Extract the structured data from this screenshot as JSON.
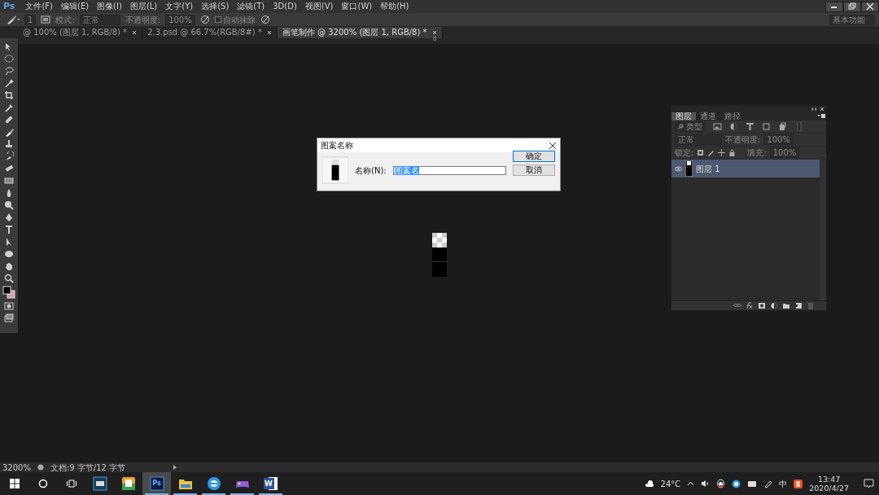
{
  "app": {
    "logo": "Ps",
    "menu": [
      "文件(F)",
      "编辑(E)",
      "图像(I)",
      "图层(L)",
      "文字(Y)",
      "选择(S)",
      "滤镜(T)",
      "3D(D)",
      "视图(V)",
      "窗口(W)",
      "帮助(H)"
    ]
  },
  "options": {
    "brush_size": "1",
    "mode_label": "模式:",
    "mode": "正常",
    "opacity_label": "不透明度:",
    "opacity": "100%",
    "auto_erase": {
      "label": "自动抹除",
      "checked": false
    },
    "workspace": "基本功能"
  },
  "doc_tabs": [
    {
      "label": "@ 100% (图层 1, RGB/8) *",
      "selected": false
    },
    {
      "label": "2.3.psd @ 66.7%(RGB/8#) *",
      "selected": false
    },
    {
      "label": "画笔制作 @ 3200% (图层 1, RGB/8) *",
      "selected": true
    }
  ],
  "ruler": {
    "zero": "0"
  },
  "dialog": {
    "title": "图案名称",
    "name_label": "名称(N):",
    "name_value": "图案名",
    "ok": "确定",
    "cancel": "取消"
  },
  "layers_panel": {
    "tabs": [
      {
        "label": "图层",
        "selected": true
      },
      {
        "label": "通道",
        "selected": false
      },
      {
        "label": "路径",
        "selected": false
      }
    ],
    "filter": "类型",
    "blend_mode": "正常",
    "opacity_label": "不透明度:",
    "opacity": "100%",
    "lock_label": "锁定:",
    "fill_label": "填充:",
    "fill": "100%",
    "layers": [
      {
        "name": "图层 1",
        "visible": true,
        "selected": true
      }
    ]
  },
  "status_bar": {
    "zoom": "3200%",
    "doc": "文档:9 字节/12 字节"
  },
  "taskbar": {
    "apps": [
      {
        "kind": "film",
        "selected": false,
        "running": false
      },
      {
        "kind": "gallery",
        "selected": false,
        "running": false
      },
      {
        "kind": "ps",
        "label": "Ps",
        "selected": true,
        "running": true
      },
      {
        "kind": "folder",
        "selected": false,
        "running": true
      },
      {
        "kind": "browser",
        "selected": false,
        "running": true
      },
      {
        "kind": "game",
        "selected": false,
        "running": true
      },
      {
        "kind": "word",
        "label": "W",
        "selected": false,
        "running": true
      }
    ],
    "weather": "24°C",
    "ime": "中",
    "time": "13:47",
    "date": "2020/4/27"
  }
}
